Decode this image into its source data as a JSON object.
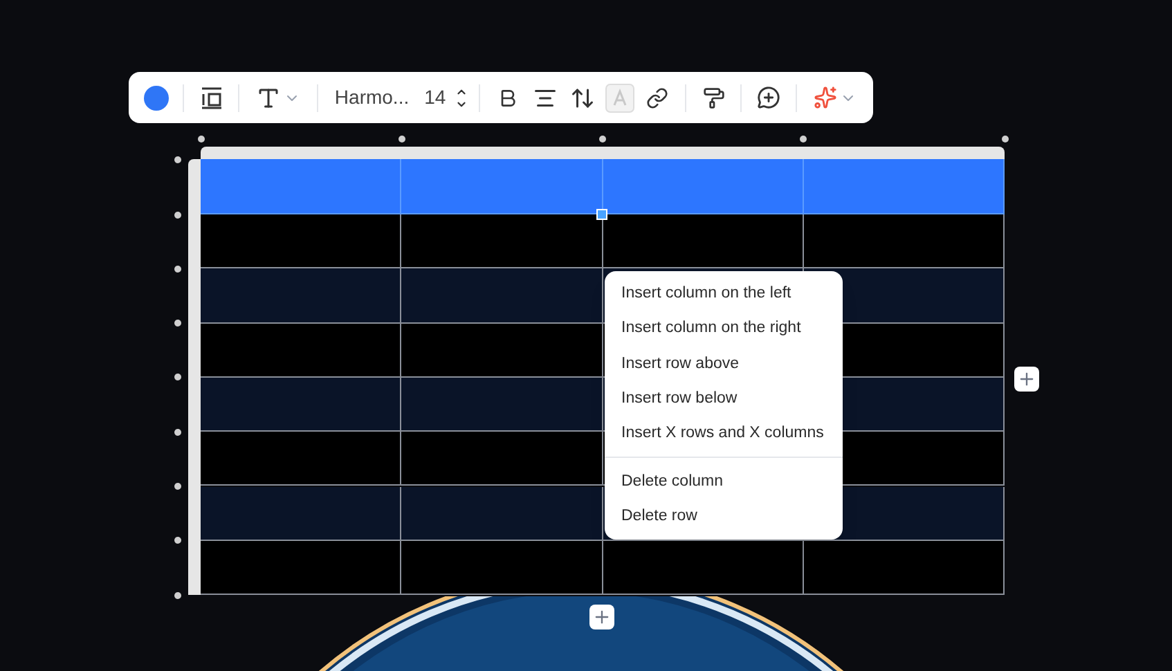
{
  "toolbar": {
    "font": "Harmo...",
    "font_size": "14"
  },
  "table": {
    "rows": [
      {
        "selected": true
      },
      {
        "selected": false
      },
      {
        "selected": false
      },
      {
        "selected": false
      },
      {
        "selected": false
      },
      {
        "selected": false
      },
      {
        "selected": false
      },
      {
        "selected": false
      }
    ]
  },
  "context_menu": {
    "groups": [
      [
        "Insert column on the left",
        "Insert column on the right",
        "Insert row above",
        "Insert row below",
        "Insert X rows and X columns"
      ],
      [
        "Delete column",
        "Delete row"
      ]
    ]
  }
}
